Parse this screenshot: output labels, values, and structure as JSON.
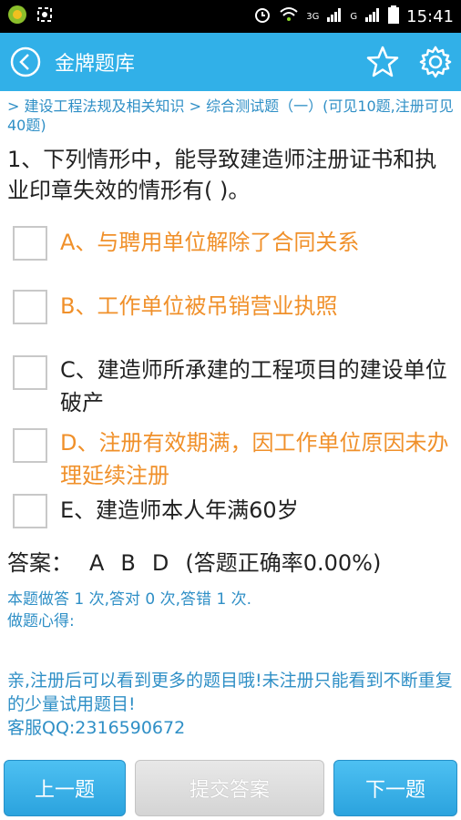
{
  "status": {
    "time": "15:41",
    "net1": "3G",
    "net2": "G",
    "icons": [
      "app-icon",
      "screenshot-icon",
      "alarm-icon",
      "wifi-icon",
      "signal-icon",
      "battery-icon"
    ]
  },
  "header": {
    "title": "金牌题库",
    "back_icon": "back-circle-icon",
    "star_icon": "star-icon",
    "settings_icon": "gear-icon",
    "color": "#31b0e8"
  },
  "breadcrumb": "> 建设工程法规及相关知识 > 综合测试题（一）(可见10题,注册可见40题)",
  "question": "1、下列情形中，能导致建造师注册证书和执业印章失效的情形有( )。",
  "options": [
    {
      "label": "A、与聘用单位解除了合同关系",
      "color": "#f0902a"
    },
    {
      "label": "B、工作单位被吊销营业执照",
      "color": "#f0902a"
    },
    {
      "label": "C、建造师所承建的工程项目的建设单位破产",
      "color": "#222222"
    },
    {
      "label": "D、注册有效期满，因工作单位原因未办理延续注册",
      "color": "#f0902a"
    },
    {
      "label": "E、建造师本人年满60岁",
      "color": "#222222"
    }
  ],
  "answer": {
    "prefix": "答案：",
    "letters": [
      "A",
      "B",
      "D"
    ],
    "rate": "(答题正确率0.00%)"
  },
  "stats": {
    "line1": "本题做答 1 次,答对 0 次,答错 1 次.",
    "line2": "做题心得:"
  },
  "notice": {
    "line1": "亲,注册后可以看到更多的题目哦!未注册只能看到不断重复的少量试用题目!",
    "line2": "客服QQ:2316590672"
  },
  "buttons": {
    "prev": "上一题",
    "submit": "提交答案",
    "next": "下一题"
  }
}
